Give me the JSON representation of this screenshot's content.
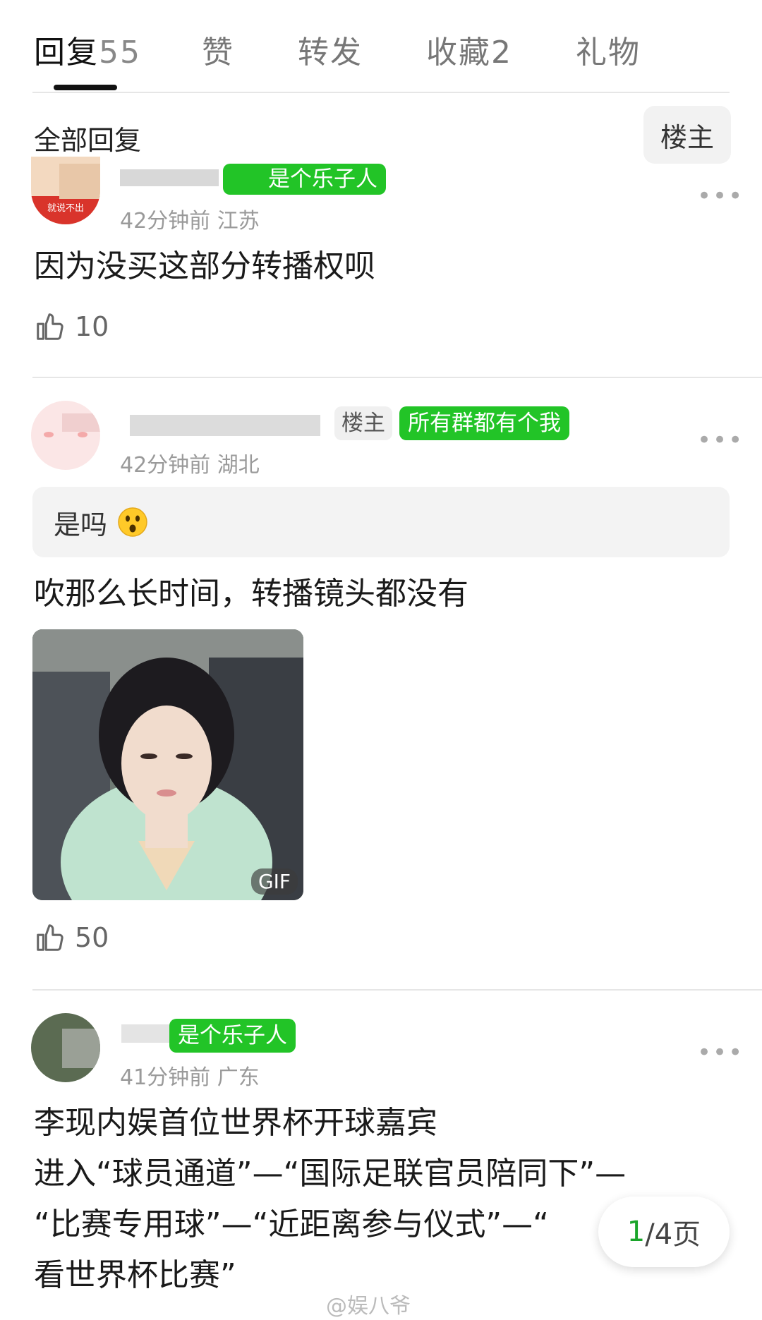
{
  "tabs": {
    "reply": {
      "label": "回复",
      "count": "55"
    },
    "like": {
      "label": "赞"
    },
    "forward": {
      "label": "转发"
    },
    "favorite": {
      "label": "收藏",
      "count": "2"
    },
    "gift": {
      "label": "礼物"
    }
  },
  "filter": {
    "title": "全部回复",
    "op_only": "楼主"
  },
  "comments": [
    {
      "badge": "是个乐子人",
      "meta": "42分钟前 江苏",
      "text": "因为没买这部分转播权呗",
      "likes": "10",
      "avatar_text": "就说不出"
    },
    {
      "op_badge": "楼主",
      "badge": "所有群都有个我",
      "meta": "42分钟前 湖北",
      "quote": "是吗",
      "text": "吹那么长时间，转播镜头都没有",
      "gif_label": "GIF",
      "likes": "50"
    },
    {
      "badge": "是个乐子人",
      "meta": "41分钟前 广东",
      "lines": [
        "李现内娱首位世界杯开球嘉宾",
        "进入“球员通道”—“国际足联官员陪同下”—",
        "“比赛专用球”—“近距离参与仪式”—“",
        "看世界杯比赛”"
      ]
    }
  ],
  "pager": {
    "current": "1",
    "total": "/4页"
  },
  "watermark": "@娱八爷",
  "colors": {
    "accent_green": "#22c427",
    "page_green": "#1aa52a"
  }
}
